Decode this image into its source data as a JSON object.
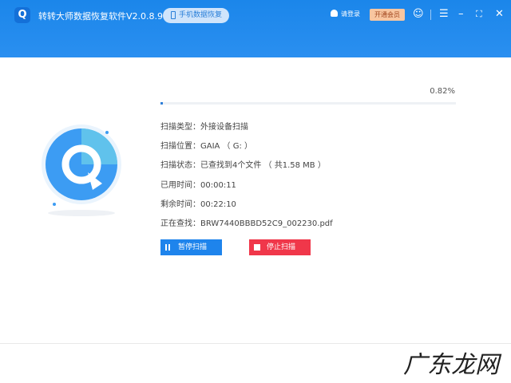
{
  "header": {
    "logo_letter": "Q",
    "title": "转转大师数据恢复软件V2.0.8.9",
    "phone_recovery": "手机数据恢复",
    "login": "请登录",
    "vip": "开通会员"
  },
  "progress": {
    "percent_label": "0.82%",
    "value": 0.82
  },
  "info": [
    {
      "label": "扫描类型：",
      "value": "外接设备扫描"
    },
    {
      "label": "扫描位置：",
      "value": "GAIA （ G: ）"
    },
    {
      "label": "扫描状态：",
      "value": "已查找到4个文件 （ 共1.58 MB ）"
    },
    {
      "label": "已用时间：",
      "value": "00:00:11"
    },
    {
      "label": "剩余时间：",
      "value": "00:22:10"
    },
    {
      "label": "正在查找：",
      "value": "BRW7440BBBD52C9_002230.pdf"
    }
  ],
  "buttons": {
    "pause": "暂停扫描",
    "stop": "停止扫描"
  },
  "watermark": "广东龙网"
}
